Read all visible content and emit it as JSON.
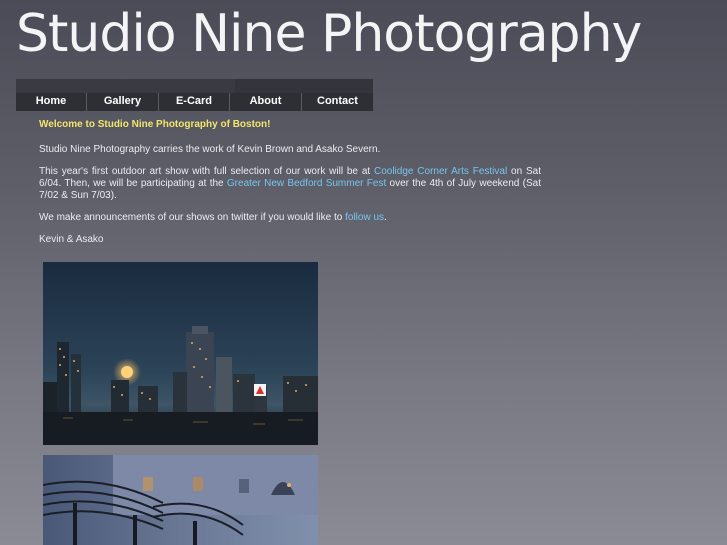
{
  "site": {
    "title": "Studio Nine Photography"
  },
  "nav": {
    "items": [
      "Home",
      "Gallery",
      "E-Card",
      "About",
      "Contact"
    ]
  },
  "content": {
    "welcome": "Welcome to Studio Nine Photography of Boston!",
    "intro": "Studio Nine Photography carries the work of Kevin Brown and Asako Severn.",
    "show_p1": "This year's first outdoor art show with full selection of our work will be at ",
    "show_link1": "Coolidge Corner Arts Festival",
    "show_p2": " on Sat 6/04.  Then, we will be participating at the ",
    "show_link2": "Greater New Bedford Summer Fest",
    "show_p3": " over the 4th of July weekend (Sat 7/02 & Sun 7/03).",
    "twitter_p1": "We make announcements of our shows on twitter if you would like to ",
    "twitter_link": "follow us",
    "twitter_p2": ".",
    "signature": "Kevin & Asako"
  },
  "colors": {
    "welcome": "#f2e66a",
    "link": "#78c4ee",
    "nav_bg": "#2e2f35"
  }
}
